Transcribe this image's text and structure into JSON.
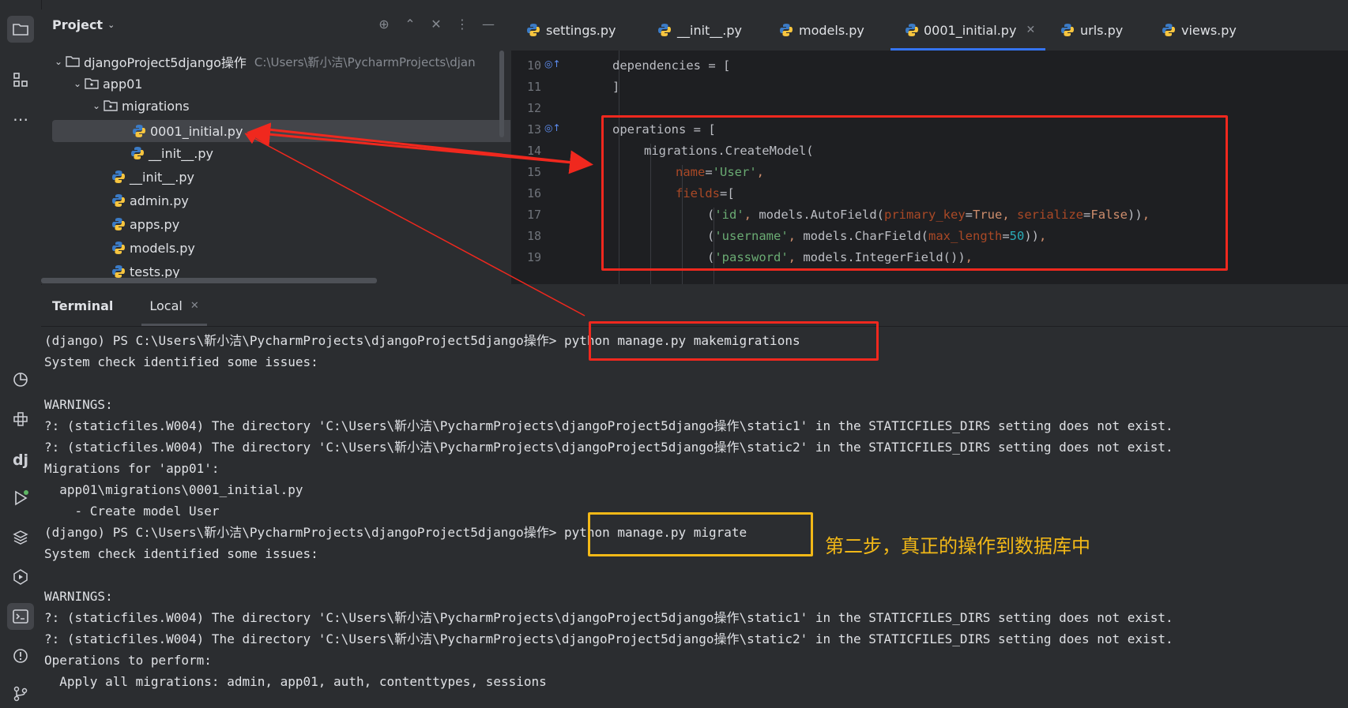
{
  "project_panel": {
    "title": "Project",
    "tree": [
      {
        "label": "djangoProject5django操作",
        "path": "C:\\Users\\靳小洁\\PycharmProjects\\djan",
        "type": "folder",
        "expanded": true
      },
      {
        "label": "app01",
        "type": "folder",
        "expanded": true
      },
      {
        "label": "migrations",
        "type": "folder",
        "expanded": true
      },
      {
        "label": "0001_initial.py",
        "type": "python",
        "selected": true
      },
      {
        "label": "__init__.py",
        "type": "python"
      },
      {
        "label": "__init__.py",
        "type": "python"
      },
      {
        "label": "admin.py",
        "type": "python"
      },
      {
        "label": "apps.py",
        "type": "python"
      },
      {
        "label": "models.py",
        "type": "python"
      },
      {
        "label": "tests.py",
        "type": "python"
      }
    ]
  },
  "editor": {
    "tabs": [
      {
        "label": "settings.py",
        "active": false
      },
      {
        "label": "__init__.py",
        "active": false
      },
      {
        "label": "models.py",
        "active": false
      },
      {
        "label": "0001_initial.py",
        "active": true
      },
      {
        "label": "urls.py",
        "active": false
      },
      {
        "label": "views.py",
        "active": false
      }
    ],
    "line_numbers": [
      "10",
      "11",
      "12",
      "13",
      "14",
      "15",
      "16",
      "17",
      "18",
      "19"
    ]
  },
  "terminal": {
    "title": "Terminal",
    "tab": "Local",
    "lines": [
      "(django) PS C:\\Users\\靳小洁\\PycharmProjects\\djangoProject5django操作> python manage.py makemigrations",
      "System check identified some issues:",
      "",
      "WARNINGS:",
      "?: (staticfiles.W004) The directory 'C:\\Users\\靳小洁\\PycharmProjects\\djangoProject5django操作\\static1' in the STATICFILES_DIRS setting does not exist.",
      "?: (staticfiles.W004) The directory 'C:\\Users\\靳小洁\\PycharmProjects\\djangoProject5django操作\\static2' in the STATICFILES_DIRS setting does not exist.",
      "Migrations for 'app01':",
      "  app01\\migrations\\0001_initial.py",
      "    - Create model User",
      "(django) PS C:\\Users\\靳小洁\\PycharmProjects\\djangoProject5django操作> python manage.py migrate",
      "System check identified some issues:",
      "",
      "WARNINGS:",
      "?: (staticfiles.W004) The directory 'C:\\Users\\靳小洁\\PycharmProjects\\djangoProject5django操作\\static1' in the STATICFILES_DIRS setting does not exist.",
      "?: (staticfiles.W004) The directory 'C:\\Users\\靳小洁\\PycharmProjects\\djangoProject5django操作\\static2' in the STATICFILES_DIRS setting does not exist.",
      "Operations to perform:",
      "  Apply all migrations: admin, app01, auth, contenttypes, sessions"
    ]
  },
  "annotation": {
    "text": "第二步，真正的操作到数据库中",
    "red": "#f0281e",
    "yellow": "#f2b817"
  },
  "colors": {
    "accent": "#3574f0",
    "keyword": "#cf8e6d",
    "string": "#6aab73",
    "param": "#aa4926"
  }
}
